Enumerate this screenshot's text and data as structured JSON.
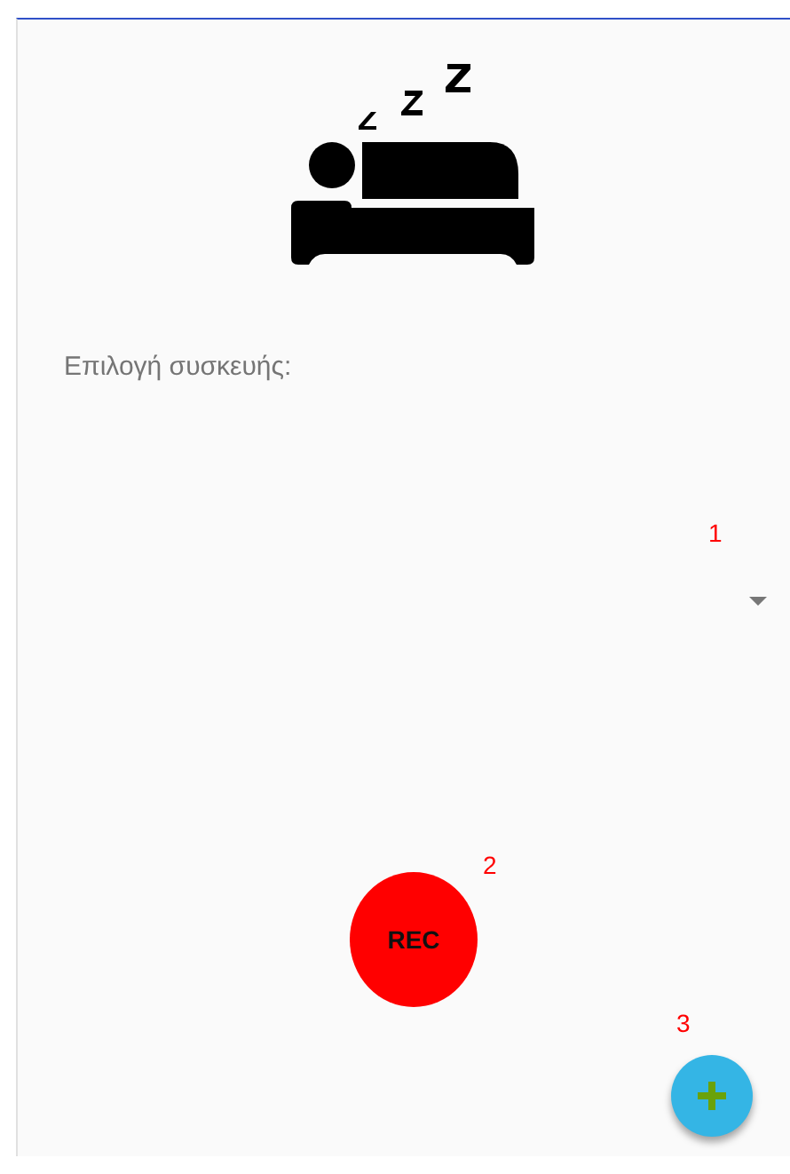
{
  "device_label": "Επιλογή συσκευής:",
  "record_button": {
    "label": "REC"
  },
  "annotations": [
    "1",
    "2",
    "3"
  ]
}
